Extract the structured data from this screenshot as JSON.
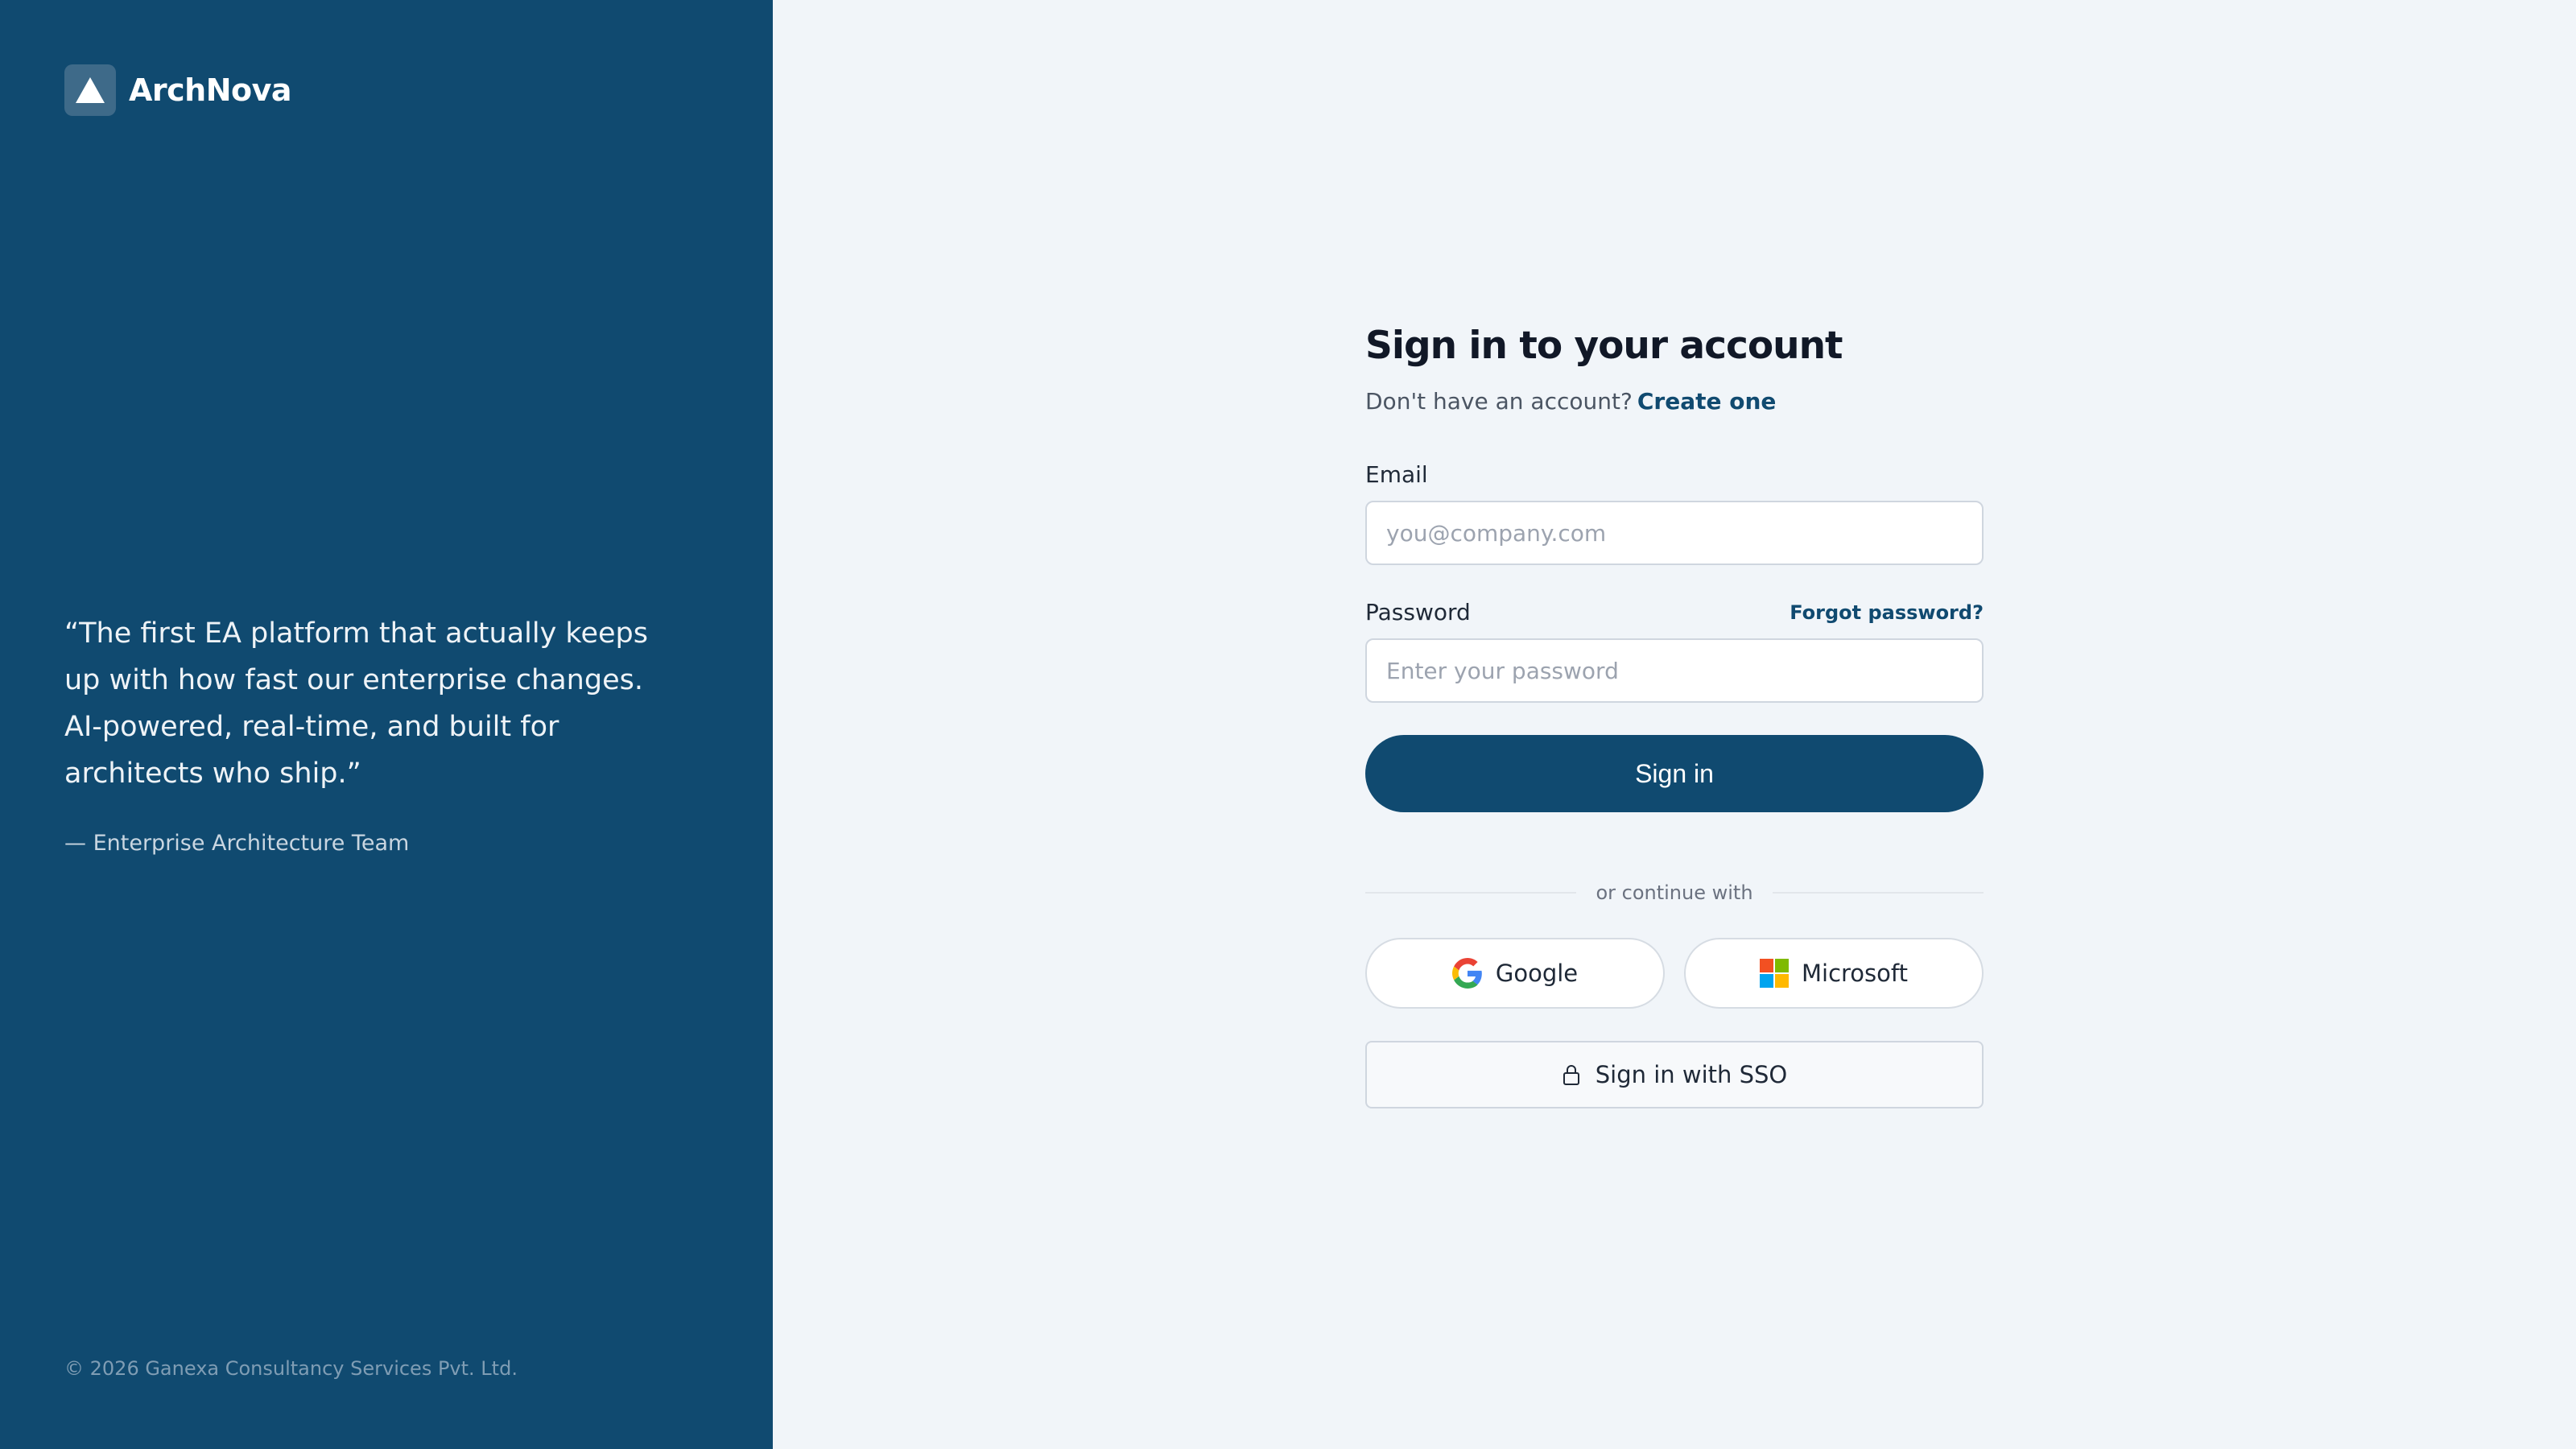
{
  "brand": {
    "name": "ArchNova",
    "quote": "“The first EA platform that actually keeps up with how fast our enterprise changes. AI-powered, real-time, and built for architects who ship.”",
    "quote_author": "— Enterprise Architecture Team",
    "copyright": "© 2026 Ganexa Consultancy Services Pvt. Ltd."
  },
  "form": {
    "title": "Sign in to your account",
    "subtitle_text": "Don't have an account?",
    "create_link": "Create one",
    "email_label": "Email",
    "email_placeholder": "you@company.com",
    "email_value": "",
    "password_label": "Password",
    "forgot_link": "Forgot password?",
    "password_placeholder": "Enter your password",
    "password_value": "",
    "signin_label": "Sign in",
    "divider_text": "or continue with",
    "google_label": "Google",
    "microsoft_label": "Microsoft",
    "sso_label": "Sign in with SSO"
  },
  "colors": {
    "brand_panel": "#104a70",
    "primary": "#104a70",
    "page_bg": "#f1f5f9"
  },
  "icons": {
    "logo": "mountain-triangle-icon",
    "google": "google-g-icon",
    "microsoft": "microsoft-squares-icon",
    "sso": "lock-icon"
  }
}
